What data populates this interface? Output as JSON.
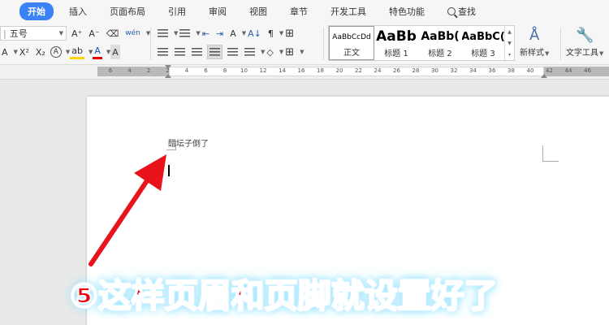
{
  "menu": {
    "tabs": [
      "开始",
      "插入",
      "页面布局",
      "引用",
      "审阅",
      "视图",
      "章节",
      "开发工具",
      "特色功能"
    ],
    "search_label": "查找"
  },
  "ribbon": {
    "font_size_value": "五号",
    "styles": [
      {
        "preview": "AaBbCcDd",
        "name": "正文"
      },
      {
        "preview": "AaBb",
        "name": "标题 1"
      },
      {
        "preview": "AaBb(",
        "name": "标题 2"
      },
      {
        "preview": "AaBbC(",
        "name": "标题 3"
      }
    ],
    "new_style_label": "新样式",
    "text_tools_label": "文字工具",
    "btn_grow": "A⁺",
    "btn_shrink": "A⁻",
    "btn_phonetic": "wén",
    "btn_superscript": "X²",
    "btn_subscript": "X₂",
    "btn_text_effect": "A",
    "btn_highlight": "ab",
    "btn_font_color": "A",
    "btn_char_shade": "A",
    "btn_sort": "A↓",
    "btn_show_marks": "¶"
  },
  "ruler": {
    "ticks": [
      "6",
      "4",
      "2",
      "2",
      "4",
      "6",
      "8",
      "10",
      "12",
      "14",
      "16",
      "18",
      "20",
      "22",
      "24",
      "26",
      "28",
      "30",
      "32",
      "34",
      "36",
      "38",
      "40",
      "42",
      "44",
      "46"
    ]
  },
  "document": {
    "header_text": "醋坛子倒了"
  },
  "annotation": {
    "caption": "⑤这样页眉和页脚就设置好了"
  },
  "colors": {
    "accent": "#3b82f6",
    "annotation_red": "#e60012",
    "arrow_red": "#e8131b"
  }
}
